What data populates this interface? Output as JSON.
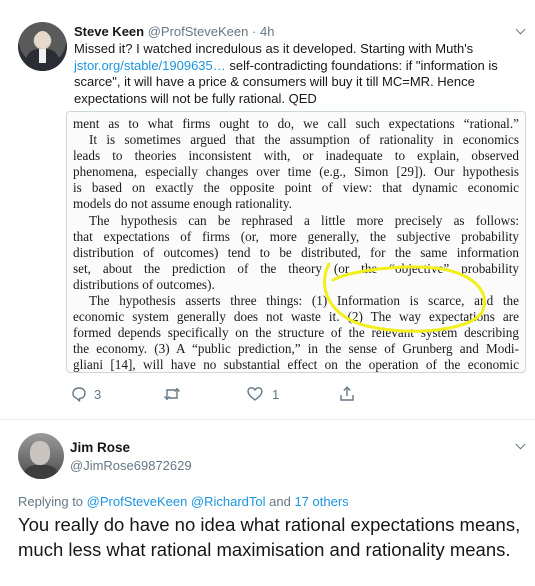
{
  "tweet": {
    "author_name": "Steve Keen",
    "author_handle": "@ProfSteveKeen",
    "separator": "·",
    "time": "4h",
    "text_before_link": "Missed it? I watched incredulous as it developed. Starting with Muth's ",
    "link_text": "jstor.org/stable/1909635…",
    "text_after_link": " self-contradicting foundations: if \"information is scarce\", it will have a price & consumers will buy it till MC=MR. Hence expectations will not be fully rational. QED",
    "image_text": [
      "ment as to what firms ought to do, we call such expectations “rational.”",
      "It is sometimes argued that the assumption of rationality in economics",
      "leads to theories inconsistent with, or inadequate to explain, observed",
      "phenomena, especially changes over time (e.g., Simon [29]). Our hypothesis",
      "is based on exactly the opposite point of view: that dynamic economic",
      "models do not assume enough rationality.",
      "The hypothesis can be rephrased a little more precisely as follows:",
      "that expectations of firms (or, more generally, the subjective probability",
      "distribution of outcomes) tend to be distributed, for the same information",
      "set, about the prediction of the theory (or the “objective” probability",
      "distributions of outcomes).",
      "The hypothesis asserts three things: (1) Information is scarce, and the",
      "economic system generally does not waste it. (2) The way expectations are",
      "formed depends specifically on the structure of the relevant system describing",
      "the economy. (3) A “public prediction,” in the sense of Grunberg and Modi-",
      "gliani [14], will have no substantial effect on the operation of the economic"
    ],
    "reply_count": "3",
    "retweet_count": "",
    "like_count": "1",
    "highlight_color": "#f2ef1c",
    "accent_color": "#1b95e0"
  },
  "reply": {
    "author_name": "Jim Rose",
    "author_handle": "@JimRose69872629",
    "replying_prefix": "Replying to ",
    "replying_to": "@ProfSteveKeen @RichardTol",
    "replying_and": " and ",
    "replying_others": "17 others",
    "text": "You really do have no idea what rational expectations means, much less what rational maximisation and rationality means."
  },
  "icons": [
    "reply-icon",
    "retweet-icon",
    "like-icon",
    "share-icon",
    "chevron-down-icon"
  ]
}
